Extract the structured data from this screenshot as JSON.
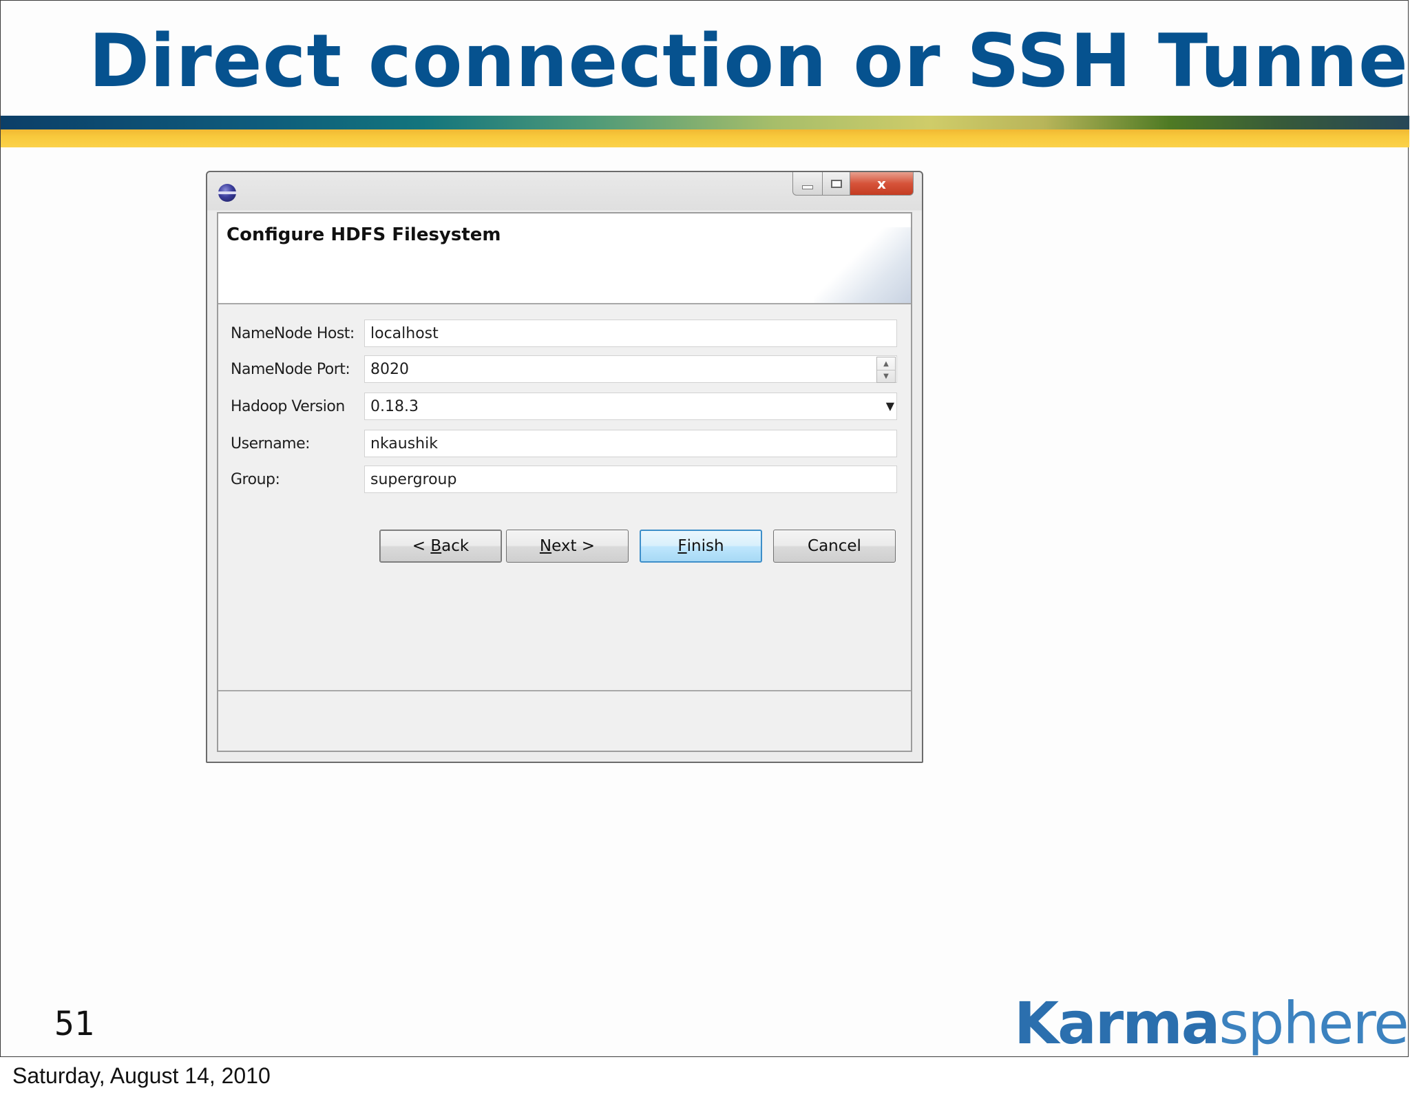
{
  "slide": {
    "title": "Direct connection or SSH Tunnel",
    "page_number": "51",
    "logo": {
      "bold_part": "Karma",
      "light_part": "sphere"
    }
  },
  "dialog": {
    "window_controls": {
      "close_glyph": "x"
    },
    "wizard_title": "Configure HDFS Filesystem",
    "fields": [
      {
        "label": "NameNode Host:",
        "value": "localhost"
      },
      {
        "label": "NameNode Port:",
        "value": "8020"
      },
      {
        "label": "Hadoop Version",
        "value": "0.18.3"
      },
      {
        "label": "Username:",
        "value": "nkaushik"
      },
      {
        "label": "Group:",
        "value": "supergroup"
      }
    ],
    "buttons": {
      "back": {
        "prefix": "< ",
        "mnemonic": "B",
        "rest": "ack"
      },
      "next": {
        "mnemonic": "N",
        "rest": "ext >"
      },
      "finish": {
        "mnemonic": "F",
        "rest": "inish"
      },
      "cancel": "Cancel"
    }
  },
  "footer": {
    "date": "Saturday, August 14, 2010"
  },
  "colors": {
    "title_blue": "#06528f",
    "accent_yellow": "#f8c93c",
    "logo_blue": "#2b6fae",
    "close_red": "#d6533a"
  },
  "icons": {
    "app": "eclipse-app-icon",
    "minimize": "minimize-icon",
    "maximize": "maximize-icon",
    "close": "close-icon",
    "spin_up": "spin-up-icon",
    "spin_down": "spin-down-icon",
    "dropdown": "chevron-down-icon"
  }
}
